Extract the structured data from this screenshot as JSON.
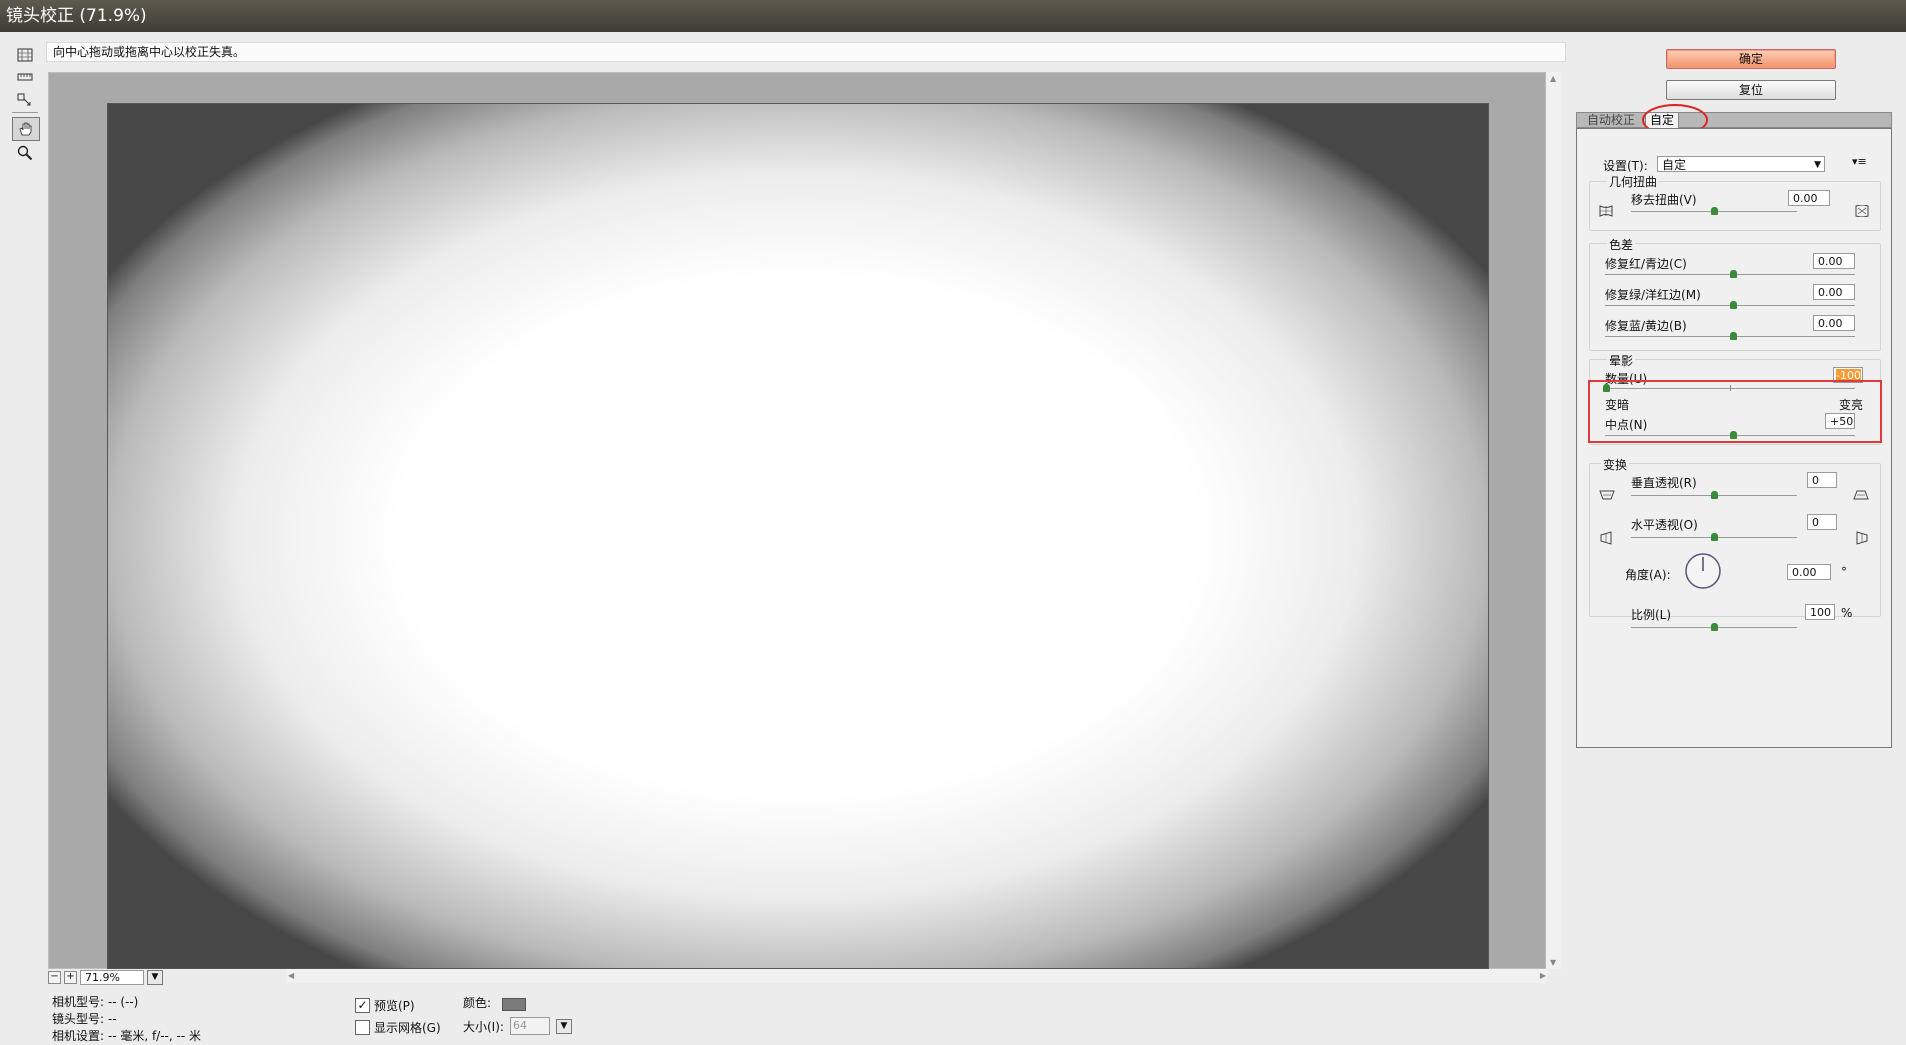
{
  "window": {
    "title": "镜头校正 (71.9%)"
  },
  "hint": "向中心拖动或拖离中心以校正失真。",
  "tools": [
    {
      "name": "remove-distortion-tool-icon"
    },
    {
      "name": "straighten-tool-icon"
    },
    {
      "name": "move-grid-tool-icon"
    },
    {
      "name": "hand-tool-icon"
    },
    {
      "name": "zoom-tool-icon"
    }
  ],
  "zoom": {
    "minus": "−",
    "plus": "+",
    "value": "71.9%"
  },
  "camera_info": {
    "model": "相机型号: -- (--)",
    "lens": "镜头型号: --",
    "settings": "相机设置: -- 毫米, f/--, -- 米"
  },
  "options": {
    "preview_label": "预览(P)",
    "preview_checked": true,
    "grid_label": "显示网格(G)",
    "grid_checked": false,
    "color_label": "颜色:",
    "grid_color": "#7b7b7b",
    "size_label": "大小(I):",
    "size_value": "64"
  },
  "buttons": {
    "ok": "确定",
    "reset": "复位"
  },
  "tabs": {
    "auto": "自动校正",
    "custom": "自定"
  },
  "settings": {
    "label": "设置(T):",
    "value": "自定",
    "menu_icon": "▾≡"
  },
  "geometric": {
    "title": "几何扭曲",
    "remove_label": "移去扭曲(V)",
    "remove_value": "0.00"
  },
  "chromatic": {
    "title": "色差",
    "rows": [
      {
        "label": "修复红/青边(C)",
        "value": "0.00"
      },
      {
        "label": "修复绿/洋红边(M)",
        "value": "0.00"
      },
      {
        "label": "修复蓝/黄边(B)",
        "value": "0.00"
      }
    ]
  },
  "vignette": {
    "title": "晕影",
    "amount_label": "数量(U)",
    "amount_value": "-100",
    "darken": "变暗",
    "lighten": "变亮",
    "midpoint_label": "中点(N)",
    "midpoint_value": "+50"
  },
  "transform": {
    "title": "变换",
    "vertical_label": "垂直透视(R)",
    "vertical_value": "0",
    "horizontal_label": "水平透视(O)",
    "horizontal_value": "0",
    "angle_label": "角度(A):",
    "angle_value": "0.00",
    "angle_unit": "°",
    "scale_label": "比例(L)",
    "scale_value": "100",
    "scale_unit": "%"
  }
}
